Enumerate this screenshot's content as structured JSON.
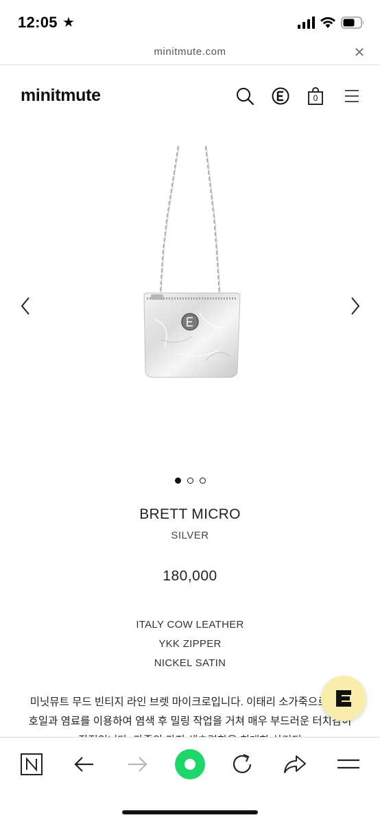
{
  "status_bar": {
    "time": "12:05",
    "star_icon": "star-icon",
    "signal_icon": "cellular-signal-icon",
    "wifi_icon": "wifi-icon",
    "battery_icon": "battery-icon"
  },
  "browser": {
    "url": "minitmute.com",
    "close_icon": "close-icon"
  },
  "header": {
    "logo": "minitmute",
    "icons": [
      "search-icon",
      "e-brand-icon",
      "shopping-bag-icon",
      "menu-icon"
    ],
    "cart_count": "0"
  },
  "gallery": {
    "image": "silver-chain-mini-bag",
    "slide_count": 3,
    "active_slide": 1,
    "prev_icon": "chevron-left-icon",
    "next_icon": "chevron-right-icon"
  },
  "product": {
    "name": "BRETT MICRO",
    "color": "SILVER",
    "price": "180,000",
    "specs": [
      "ITALY COW LEATHER",
      "YKK ZIPPER",
      "NICKEL SATIN"
    ],
    "description": "미닛뮤트 무드 빈티지 라인 브렛 마이크로입니다. 이태리 소가죽으로 특수 호일과 염료를 이용하여 염색 후 밀링 작업을 거쳐 매우 부드러운 터치감이 장점입니다. 가죽의 가지 색츠력한을 최대한 살리디"
  },
  "floating_button": {
    "icon": "e-brand-icon",
    "color": "#f9edae"
  },
  "toolbar": {
    "items": [
      "naver-icon",
      "back-arrow-icon",
      "forward-arrow-icon",
      "green-home-icon",
      "refresh-icon",
      "share-icon",
      "hamburger-menu-icon"
    ],
    "accent": "#1fd66b"
  }
}
